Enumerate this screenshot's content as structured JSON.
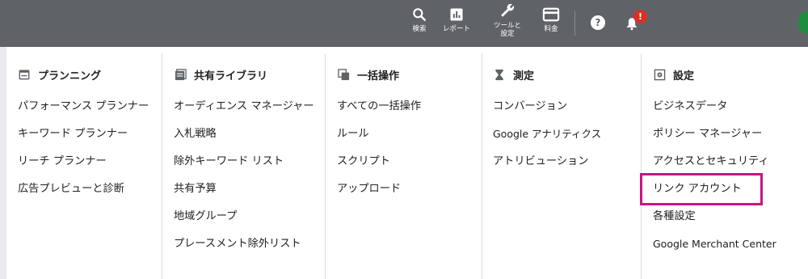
{
  "topbar": {
    "search_label": "検索",
    "reports_label": "レポート",
    "tools_label": "ツールと\n設定",
    "billing_label": "料金",
    "help_icon_text": "?",
    "notification_badge": "!"
  },
  "columns": [
    {
      "title": "プランニング",
      "icon": "calendar-icon",
      "items": [
        "パフォーマンス プランナー",
        "キーワード プランナー",
        "リーチ プランナー",
        "広告プレビューと診断"
      ]
    },
    {
      "title": "共有ライブラリ",
      "icon": "library-icon",
      "items": [
        "オーディエンス マネージャー",
        "入札戦略",
        "除外キーワード リスト",
        "共有予算",
        "地域グループ",
        "プレースメント除外リスト"
      ]
    },
    {
      "title": "一括操作",
      "icon": "copy-icon",
      "items": [
        "すべての一括操作",
        "ルール",
        "スクリプト",
        "アップロード"
      ]
    },
    {
      "title": "測定",
      "icon": "hourglass-icon",
      "items": [
        "コンバージョン",
        "Google アナリティクス",
        "アトリビューション"
      ]
    },
    {
      "title": "設定",
      "icon": "settings-icon",
      "items": [
        "ビジネスデータ",
        "ポリシー マネージャー",
        "アクセスとセキュリティ",
        "リンク アカウント",
        "各種設定",
        "Google Merchant Center"
      ]
    }
  ],
  "colors": {
    "topbar": "#5f6368",
    "highlight": "#c71585",
    "badge": "#d93025"
  }
}
